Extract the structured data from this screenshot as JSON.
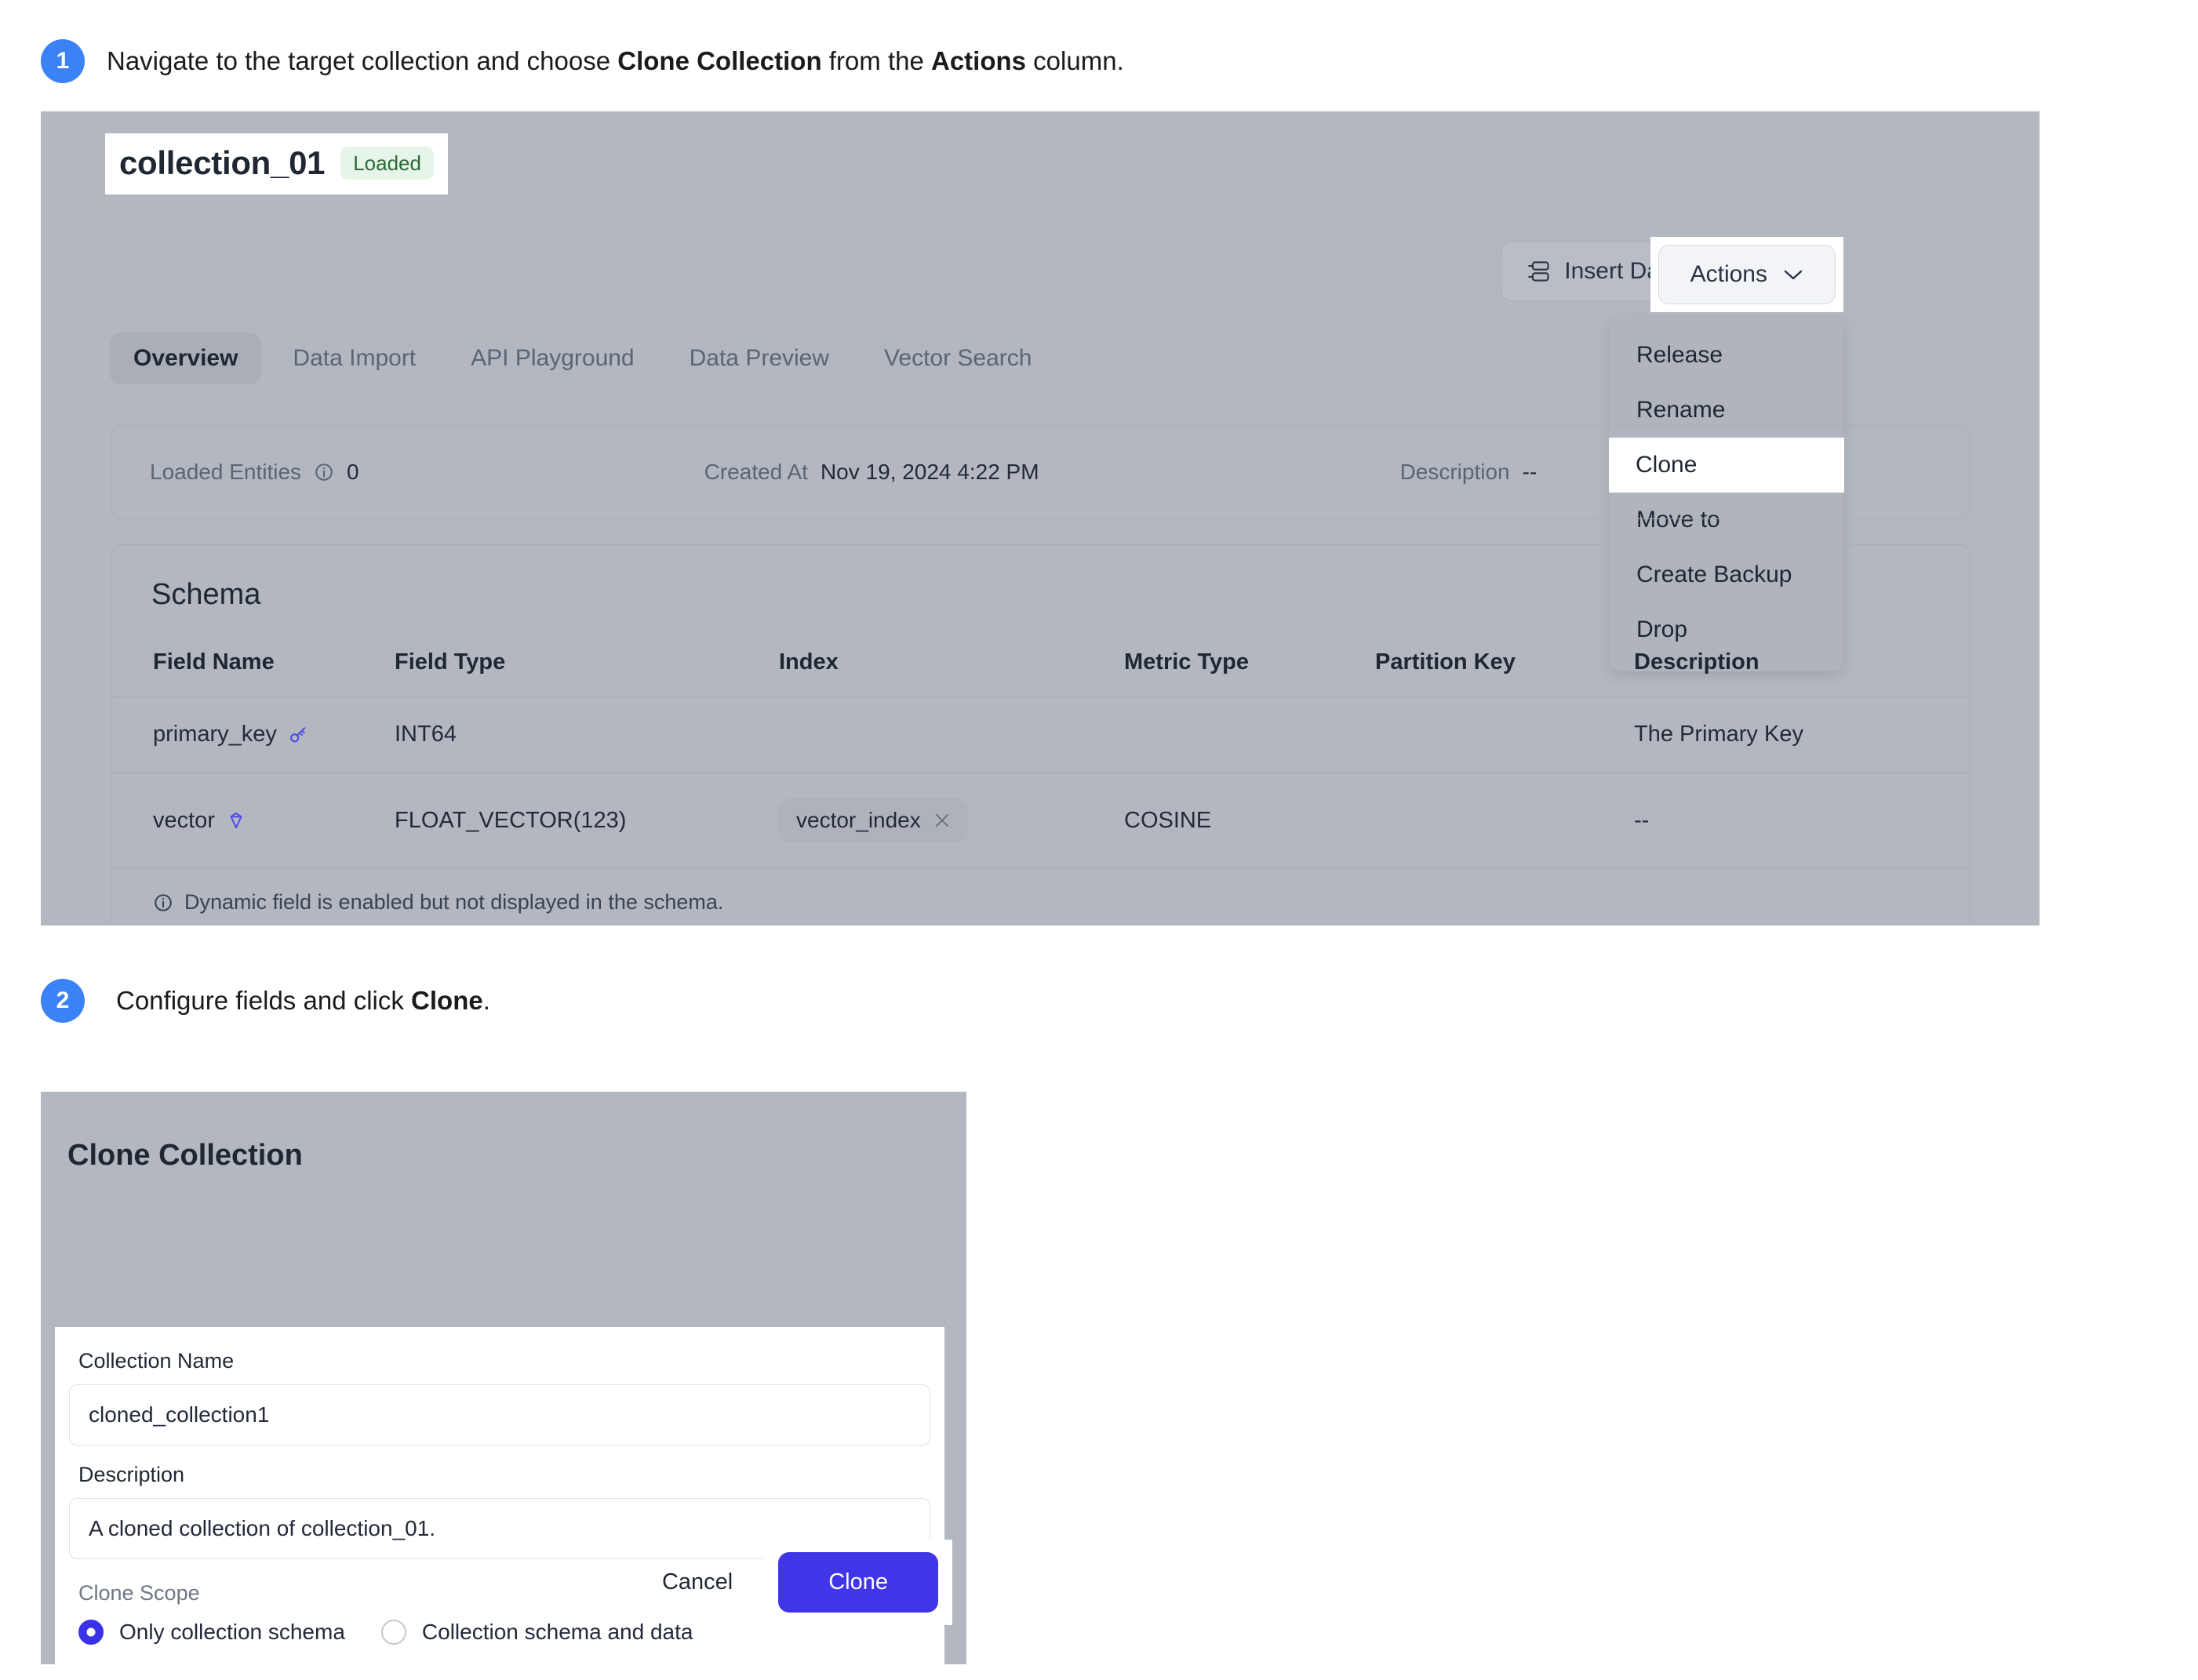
{
  "steps": [
    {
      "number": "1",
      "text_before": "Navigate to the target collection and choose ",
      "bold1": "Clone Collection",
      "text_mid": " from the ",
      "bold2": "Actions",
      "text_after": " column."
    },
    {
      "number": "2",
      "text_before": "Configure fields and click ",
      "bold1": "Clone",
      "text_after": "."
    }
  ],
  "collection_panel": {
    "name": "collection_01",
    "status_badge": "Loaded",
    "insert_data_label": "Insert Data",
    "insert_data_icon": "database-rows-icon",
    "actions_label": "Actions",
    "actions_chevron_icon": "chevron-down-icon",
    "actions_menu": [
      {
        "label": "Release",
        "highlighted": false
      },
      {
        "label": "Rename",
        "highlighted": false
      },
      {
        "label": "Clone",
        "highlighted": true
      },
      {
        "label": "Move to",
        "highlighted": false
      },
      {
        "label": "Create Backup",
        "highlighted": false
      },
      {
        "label": "Drop",
        "highlighted": false
      }
    ],
    "tabs": [
      {
        "label": "Overview",
        "active": true
      },
      {
        "label": "Data Import",
        "active": false
      },
      {
        "label": "API Playground",
        "active": false
      },
      {
        "label": "Data Preview",
        "active": false
      },
      {
        "label": "Vector Search",
        "active": false
      }
    ],
    "info": {
      "loaded_entities_label": "Loaded Entities",
      "loaded_entities_icon": "info-circle-icon",
      "loaded_entities_value": "0",
      "created_at_label": "Created At",
      "created_at_value": "Nov 19, 2024 4:22 PM",
      "description_label": "Description",
      "description_value": "--"
    },
    "schema": {
      "title": "Schema",
      "columns": [
        "Field Name",
        "Field Type",
        "Index",
        "Metric Type",
        "Partition Key",
        "Description"
      ],
      "rows": [
        {
          "field_name": "primary_key",
          "field_icon": "key-icon",
          "field_type": "INT64",
          "index": "",
          "metric_type": "",
          "partition_key": "",
          "description": "The Primary Key"
        },
        {
          "field_name": "vector",
          "field_icon": "vector-icon",
          "field_type": "FLOAT_VECTOR(123)",
          "index": "vector_index",
          "index_remove_icon": "close-icon",
          "metric_type": "COSINE",
          "partition_key": "",
          "description": "--"
        }
      ],
      "note_icon": "info-circle-icon",
      "note": "Dynamic field is enabled but not displayed in the schema."
    }
  },
  "clone_dialog": {
    "title": "Clone Collection",
    "collection_name_label": "Collection Name",
    "collection_name_value": "cloned_collection1",
    "description_label": "Description",
    "description_value": "A cloned collection of collection_01.",
    "clone_scope_label": "Clone Scope",
    "scope_options": [
      {
        "label": "Only collection schema",
        "selected": true
      },
      {
        "label": "Collection schema and data",
        "selected": false
      }
    ],
    "cancel_label": "Cancel",
    "clone_label": "Clone"
  },
  "colors": {
    "step_badge_blue": "#3b82f6",
    "primary_blue": "#4036e8",
    "radio_blue": "#3a32e8",
    "panel_gray": "#b3b8c0",
    "badge_green_bg": "#e6f5e9",
    "badge_green_text": "#2d6a36",
    "highlight_white": "#ffffff"
  }
}
